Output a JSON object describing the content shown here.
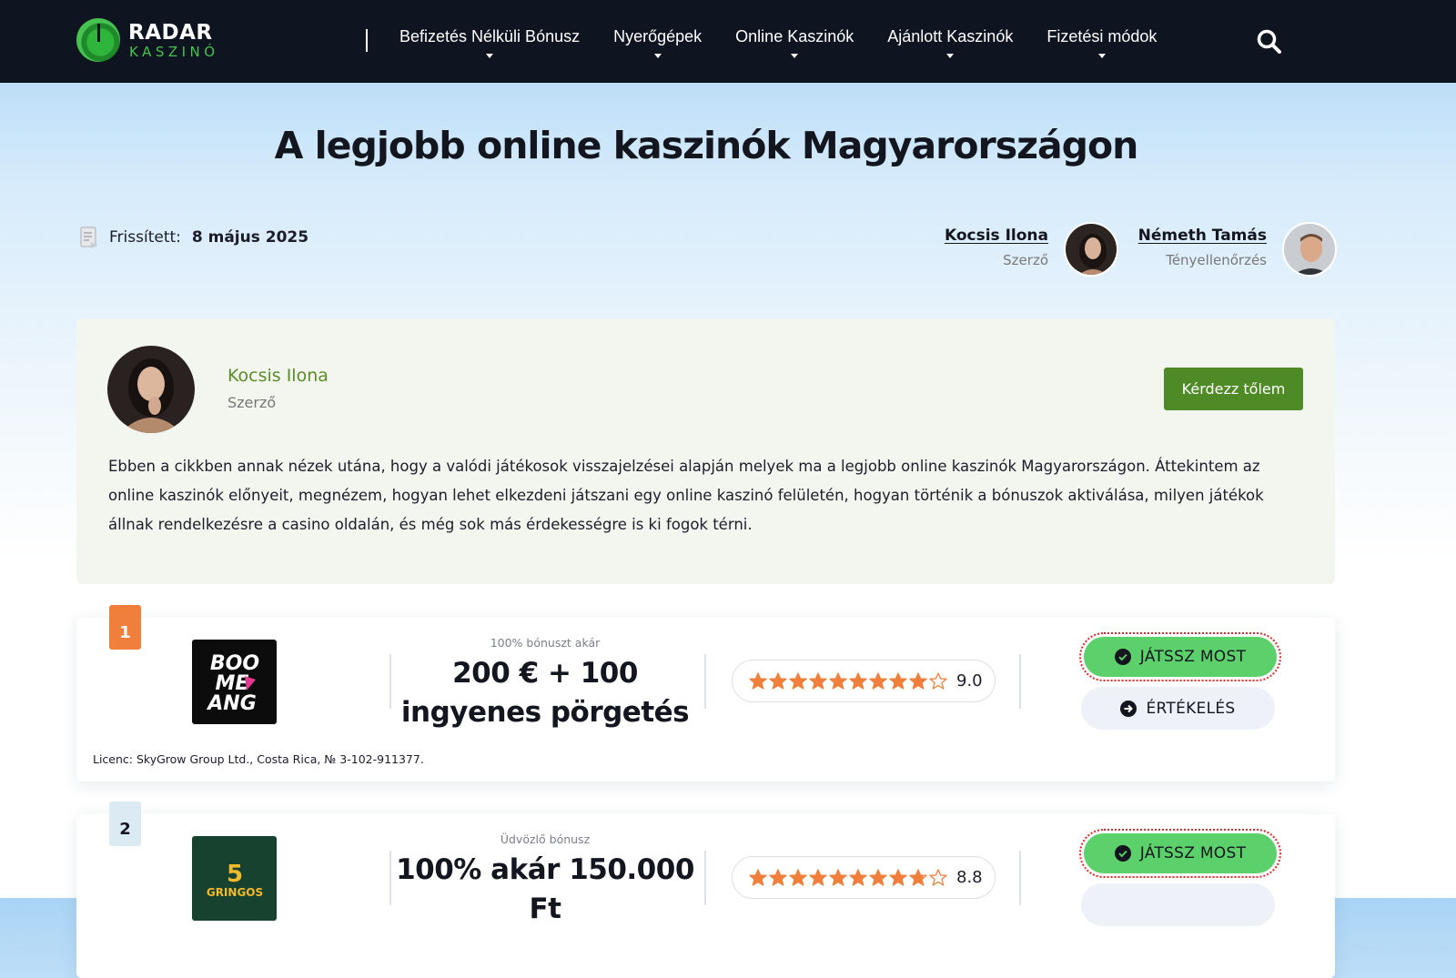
{
  "header": {
    "logo_top": "RADAR",
    "logo_bottom": "KASZINÓ",
    "nav": [
      {
        "label": "Befizetés Nélküli Bónusz"
      },
      {
        "label": "Nyerőgépek"
      },
      {
        "label": "Online Kaszinók"
      },
      {
        "label": "Ajánlott Kaszinók"
      },
      {
        "label": "Fizetési módok"
      }
    ],
    "search_icon": "search-icon"
  },
  "page": {
    "title": "A legjobb online kaszinók Magyarországon",
    "updated_label": "Frissített:",
    "updated_date": "8 május 2025"
  },
  "people": {
    "author": {
      "name": "Kocsis Ilona",
      "role": "Szerző"
    },
    "factcheck": {
      "name": "Németh Tamás",
      "role": "Tényellenőrzés"
    }
  },
  "author_box": {
    "name": "Kocsis Ilona",
    "role": "Szerző",
    "ask_button": "Kérdezz tőlem",
    "intro": "Ebben a cikkben annak nézek utána, hogy a valódi játékosok visszajelzései alapján melyek ma a legjobb online kaszinók Magyarországon. Áttekintem az online kaszinók előnyeit, megnézem, hogyan lehet elkezdeni játszani egy online kaszinó felületén, hogyan történik a bónuszok aktiválása, milyen játékok állnak rendelkezésre a casino oldalán, és még sok más érdekességre is ki fogok térni."
  },
  "casinos": [
    {
      "rank": "1",
      "logo_text": "BOOMERANG",
      "bonus_label": "100% bónuszt akár",
      "bonus_line1": "200 € + 100",
      "bonus_line2": "ingyenes pörgetés",
      "rating": 9.0,
      "score_text": "9.0",
      "play_label": "JÁTSSZ MOST",
      "review_label": "ÉRTÉKELÉS",
      "license": "Licenc: SkyGrow Group Ltd., Costa Rica, № 3-102-911377.",
      "badge_color": "#ef7f3a"
    },
    {
      "rank": "2",
      "logo_text": "5 GRINGOS",
      "bonus_label": "Üdvözlő bónusz",
      "bonus_line1": "100% akár 150.000",
      "bonus_line2": "Ft",
      "rating": 8.8,
      "score_text": "8.8",
      "play_label": "JÁTSSZ MOST",
      "badge_color": "#dcebf3"
    }
  ],
  "colors": {
    "header_bg": "#0e1420",
    "accent_green": "#4e8a25",
    "play_green": "#5bd06b",
    "star_orange": "#ef7f3a"
  }
}
